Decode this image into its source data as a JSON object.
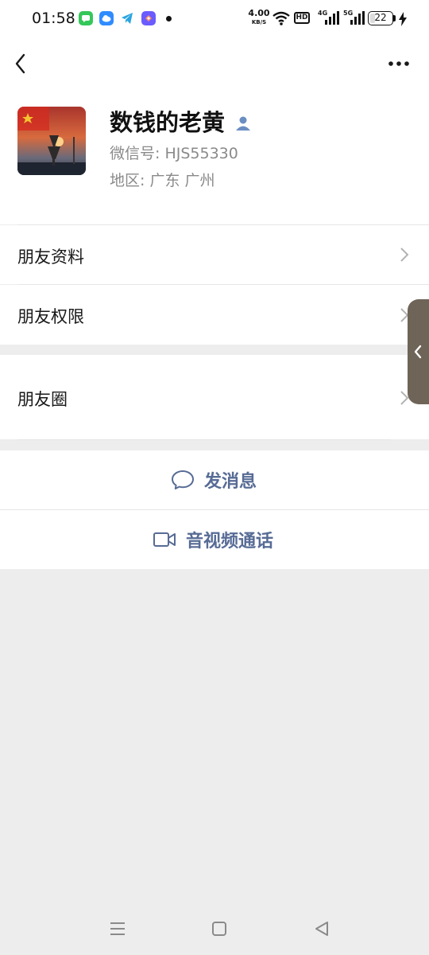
{
  "status_bar": {
    "time": "01:58",
    "net_speed_value": "4.00",
    "net_speed_unit": "KB/S",
    "hd_label": "HD",
    "sim1_label": "4G",
    "sim2_label": "5G",
    "battery": "22",
    "app_icons": [
      "messages-icon",
      "cloud-icon",
      "telegram-icon",
      "shortcut-app-icon"
    ]
  },
  "header": {
    "back_icon": "chevron-left-icon",
    "more_icon": "more-dots-icon"
  },
  "profile": {
    "name": "数钱的老黄",
    "wechat_id": "微信号:  HJS55330",
    "region": "地区:  广东  广州"
  },
  "menu": {
    "friend_info": "朋友资料",
    "friend_permissions": "朋友权限",
    "moments": "朋友圈"
  },
  "actions": {
    "send_message": "发消息",
    "av_call": "音视频通话"
  },
  "colors": {
    "link": "#576b95",
    "background": "#ededed",
    "card": "#ffffff"
  }
}
